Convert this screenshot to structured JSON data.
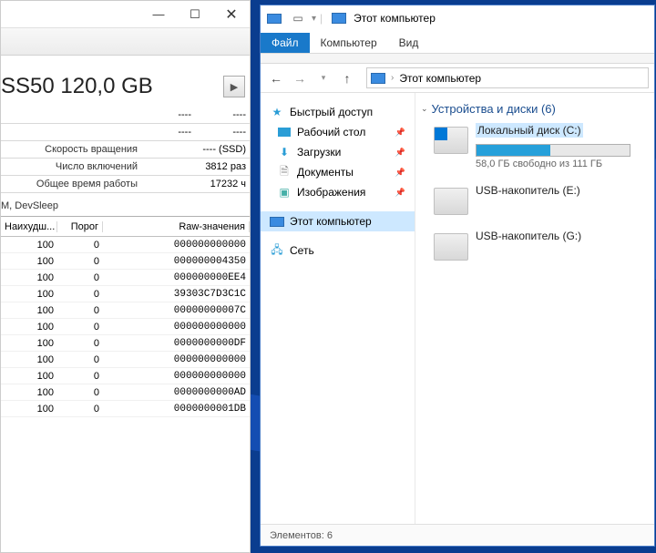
{
  "left_window": {
    "disk_title": "SS50 120,0 GB",
    "info_rows": [
      {
        "label": "",
        "v1": "----",
        "v2": "----"
      },
      {
        "label": "",
        "v1": "----",
        "v2": "----"
      },
      {
        "label": "Скорость вращения",
        "v1": "",
        "v2": "---- (SSD)"
      },
      {
        "label": "Число включений",
        "v1": "",
        "v2": "3812 раз"
      },
      {
        "label": "Общее время работы",
        "v1": "",
        "v2": "17232 ч"
      }
    ],
    "features": "M, DevSleep",
    "smart_headers": {
      "worst": "Наихудш...",
      "threshold": "Порог",
      "raw": "Raw-значения"
    },
    "smart_rows": [
      {
        "w": "100",
        "t": "0",
        "r": "000000000000"
      },
      {
        "w": "100",
        "t": "0",
        "r": "000000004350"
      },
      {
        "w": "100",
        "t": "0",
        "r": "000000000EE4"
      },
      {
        "w": "100",
        "t": "0",
        "r": "39303C7D3C1C"
      },
      {
        "w": "100",
        "t": "0",
        "r": "00000000007C"
      },
      {
        "w": "100",
        "t": "0",
        "r": "000000000000"
      },
      {
        "w": "100",
        "t": "0",
        "r": "0000000000DF"
      },
      {
        "w": "100",
        "t": "0",
        "r": "000000000000"
      },
      {
        "w": "100",
        "t": "0",
        "r": "000000000000"
      },
      {
        "w": "100",
        "t": "0",
        "r": "0000000000AD"
      },
      {
        "w": "100",
        "t": "0",
        "r": "0000000001DB"
      }
    ]
  },
  "explorer": {
    "title": "Этот компьютер",
    "tabs": {
      "file": "Файл",
      "computer": "Компьютер",
      "view": "Вид"
    },
    "breadcrumb": "Этот компьютер",
    "nav": {
      "quick": "Быстрый доступ",
      "desktop": "Рабочий стол",
      "downloads": "Загрузки",
      "documents": "Документы",
      "pictures": "Изображения",
      "this_pc": "Этот компьютер",
      "network": "Сеть"
    },
    "group_header": "Устройства и диски (6)",
    "drives": [
      {
        "name": "Локальный диск (C:)",
        "free": "58,0 ГБ свободно из 111 ГБ",
        "fill_pct": 48,
        "type": "os",
        "selected": true
      },
      {
        "name": "USB-накопитель (E:)",
        "type": "hdd"
      },
      {
        "name": "USB-накопитель (G:)",
        "type": "hdd"
      }
    ],
    "statusbar": "Элементов: 6"
  }
}
